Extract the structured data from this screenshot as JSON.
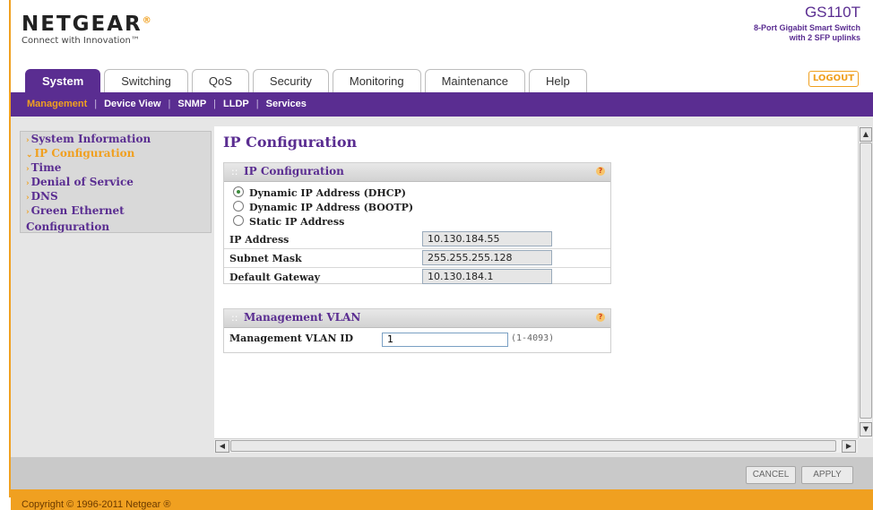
{
  "header": {
    "logo": "NETGEAR",
    "tagline": "Connect with Innovation™",
    "model": "GS110T",
    "model_desc_line1": "8-Port Gigabit Smart Switch",
    "model_desc_line2": "with 2 SFP uplinks",
    "logout": "LOGOUT"
  },
  "tabs": [
    {
      "label": "System",
      "active": true
    },
    {
      "label": "Switching",
      "active": false
    },
    {
      "label": "QoS",
      "active": false
    },
    {
      "label": "Security",
      "active": false
    },
    {
      "label": "Monitoring",
      "active": false
    },
    {
      "label": "Maintenance",
      "active": false
    },
    {
      "label": "Help",
      "active": false
    }
  ],
  "subnav": [
    {
      "label": "Management",
      "active": true
    },
    {
      "label": "Device View",
      "active": false
    },
    {
      "label": "SNMP",
      "active": false
    },
    {
      "label": "LLDP",
      "active": false
    },
    {
      "label": "Services",
      "active": false
    }
  ],
  "sidebar": {
    "items": [
      {
        "label": "System Information",
        "active": false
      },
      {
        "label": "IP Configuration",
        "active": true
      },
      {
        "label": "Time",
        "active": false
      },
      {
        "label": "Denial of Service",
        "active": false
      },
      {
        "label": "DNS",
        "active": false
      },
      {
        "label": "Green Ethernet Configuration",
        "active": false
      }
    ]
  },
  "main": {
    "title": "IP Configuration",
    "ip_panel": {
      "title": "IP Configuration",
      "radios": [
        {
          "label": "Dynamic IP Address (DHCP)",
          "selected": true
        },
        {
          "label": "Dynamic IP Address (BOOTP)",
          "selected": false
        },
        {
          "label": "Static IP Address",
          "selected": false
        }
      ],
      "fields": [
        {
          "label": "IP Address",
          "value": "10.130.184.55"
        },
        {
          "label": "Subnet Mask",
          "value": "255.255.255.128"
        },
        {
          "label": "Default Gateway",
          "value": "10.130.184.1"
        }
      ]
    },
    "vlan_panel": {
      "title": "Management VLAN",
      "label": "Management VLAN ID",
      "value": "1",
      "range": "(1-4093)"
    }
  },
  "buttons": {
    "cancel": "CANCEL",
    "apply": "APPLY"
  },
  "footer": {
    "copyright": "Copyright © 1996-2011 Netgear ®"
  },
  "colors": {
    "brand_purple": "#5a2d91",
    "brand_orange": "#f0a020"
  }
}
